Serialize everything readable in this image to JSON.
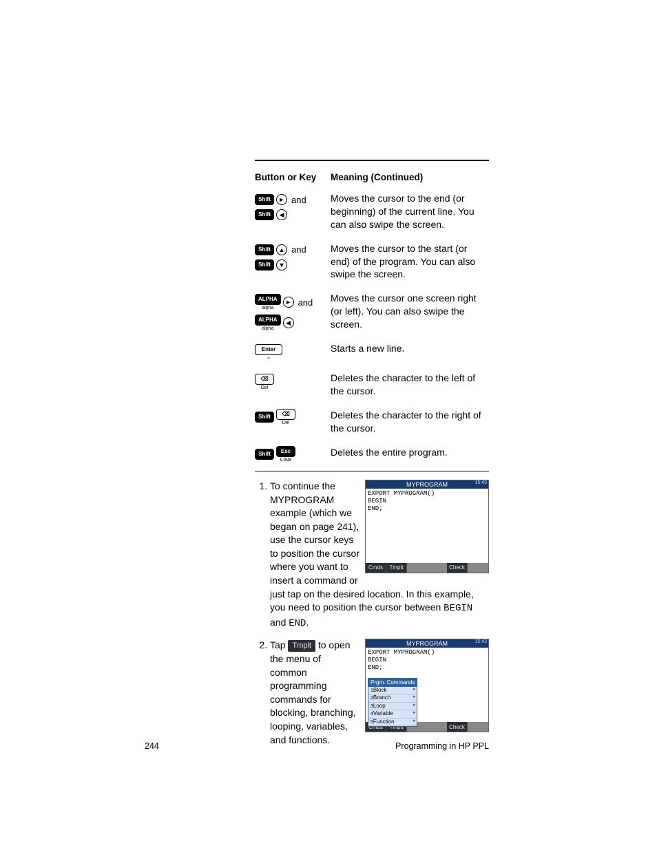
{
  "table": {
    "header_key": "Button or Key",
    "header_meaning": "Meaning  (Continued)",
    "rows": [
      {
        "key_primary_label": "Shift",
        "key_primary_arrow": "►",
        "joiner": "and",
        "key_secondary_label": "Shift",
        "key_secondary_arrow": "◀",
        "meaning": "Moves the cursor to the end (or beginning) of the current line. You can also swipe the screen."
      },
      {
        "key_primary_label": "Shift",
        "key_primary_arrow": "▲",
        "joiner": "and",
        "key_secondary_label": "Shift",
        "key_secondary_arrow": "▼",
        "meaning": "Moves the cursor to the start (or end) of the program. You can also swipe the screen."
      },
      {
        "key_primary_label": "ALPHA",
        "key_primary_sub": "alpha",
        "key_primary_arrow": "►",
        "joiner": "and",
        "key_secondary_label": "ALPHA",
        "key_secondary_sub": "alpha",
        "key_secondary_arrow": "◀",
        "meaning": "Moves the cursor one screen right (or left). You can also swipe the screen."
      },
      {
        "key_enter_top": "Enter",
        "key_enter_bottom": "≈",
        "meaning": "Starts a new line."
      },
      {
        "key_bksp": "⌫",
        "key_bksp_sub": "Del",
        "meaning": "Deletes the character to the left of the cursor."
      },
      {
        "key_primary_label": "Shift",
        "key_bksp": "⌫",
        "key_bksp_sub": "Del",
        "meaning": "Deletes the character to the right of the cursor."
      },
      {
        "key_primary_label": "Shift",
        "key_esc": "Esc",
        "key_esc_sub": "Clear",
        "meaning": "Deletes the entire program."
      }
    ]
  },
  "steps": {
    "s1_lead": "To continue the ",
    "s1_progname": "MYPROGRAM",
    "s1_mid": " example (which we began on page 241), use the cursor keys to position the cursor where you want to insert a command or just tap on the desired location. In this example, you need to position the cursor between ",
    "s1_code_begin": "BEGIN",
    "s1_and": " and ",
    "s1_code_end": "END",
    "s1_period": ".",
    "s2_lead": "Tap ",
    "s2_key": "Tmplt",
    "s2_rest": " to open the menu of common programming commands for blocking, branching, looping, variables, and functions."
  },
  "fig1": {
    "title": "MYPROGRAM",
    "time": "15:43",
    "line1": "EXPORT MYPROGRAM()",
    "line2": "BEGIN",
    "line3": "",
    "line4": "END;",
    "soft1": "Cmds",
    "soft2": "Tmplt",
    "soft_check": "Check"
  },
  "fig2": {
    "title": "MYPROGRAM",
    "time": "15:43",
    "line1": "EXPORT MYPROGRAM()",
    "line2": "BEGIN",
    "line3": "",
    "line4": "END;",
    "menu_hdr": "Prgm. Commands",
    "menu": [
      "Block",
      "Branch",
      "Loop",
      "Variable",
      "Function"
    ],
    "soft1": "Cmds",
    "soft2": "Tmplt",
    "soft_check": "Check"
  },
  "footer": {
    "page": "244",
    "section": "Programming in HP PPL"
  }
}
